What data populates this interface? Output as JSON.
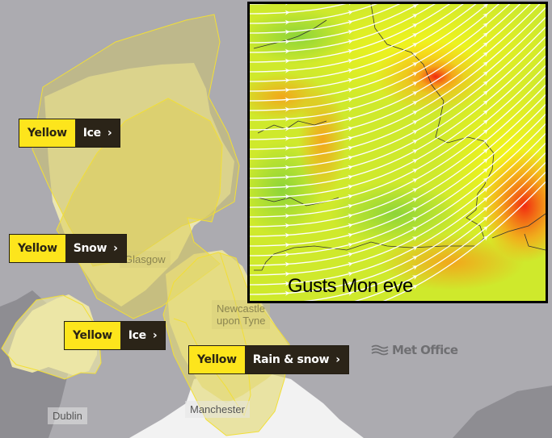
{
  "map": {
    "background_color": "#acabb0",
    "warning_fill": "#e3dc7c",
    "warning_stroke": "#f5e33a"
  },
  "warnings": [
    {
      "level": "Yellow",
      "type": "Ice"
    },
    {
      "level": "Yellow",
      "type": "Snow"
    },
    {
      "level": "Yellow",
      "type": "Ice"
    },
    {
      "level": "Yellow",
      "type": "Rain & snow"
    }
  ],
  "chevron": "›",
  "cities": [
    {
      "name": "Glasgow"
    },
    {
      "name": "Newcastle upon Tyne",
      "line1": "Newcastle",
      "line2": "upon Tyne"
    },
    {
      "name": "Manchester"
    },
    {
      "name": "Dublin"
    }
  ],
  "inset": {
    "caption": "Gusts Mon eve",
    "colors": {
      "low": "#8fd93a",
      "mid": "#f2f51c",
      "high": "#f6a019",
      "extreme": "#f22a10"
    }
  },
  "branding": {
    "logo_text": "Met Office"
  }
}
